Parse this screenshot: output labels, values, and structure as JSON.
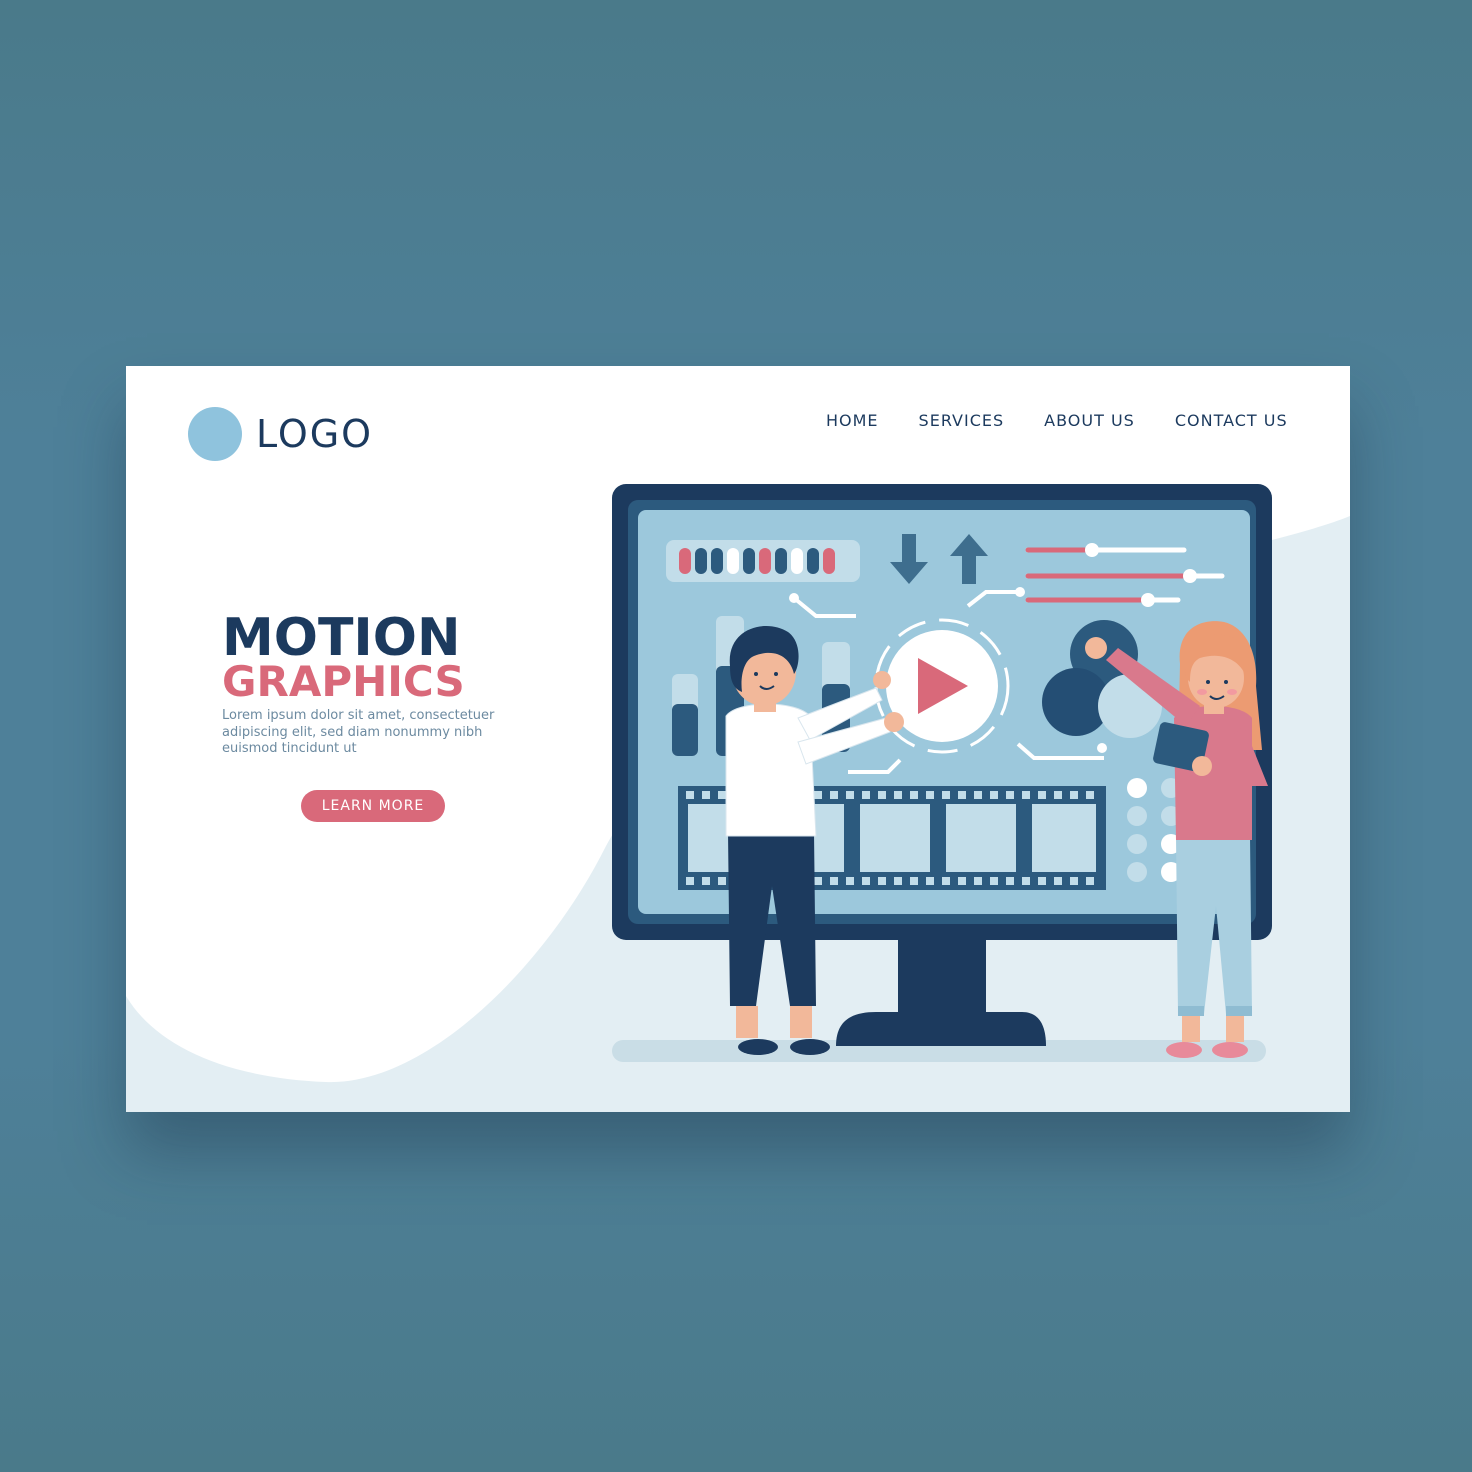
{
  "header": {
    "logo_text": "LOGO",
    "nav": [
      {
        "label": "HOME"
      },
      {
        "label": "SERVICES"
      },
      {
        "label": "ABOUT US"
      },
      {
        "label": "CONTACT US"
      }
    ]
  },
  "hero": {
    "title_line1": "MOTION",
    "title_line2": "GRAPHICS",
    "body": "Lorem ipsum dolor sit amet, consectetuer adipiscing elit, sed diam nonummy nibh euismod tincidunt ut",
    "cta_label": "LEARN MORE"
  },
  "colors": {
    "navy": "#1c3a5e",
    "coral": "#d9697a",
    "light_blue": "#8fc3dd",
    "screen_blue": "#9cc8dc",
    "background": "#4e8099"
  },
  "illustration": {
    "icons": [
      "play-icon",
      "download-arrow-icon",
      "upload-arrow-icon",
      "film-strip-icon",
      "tablet-icon"
    ]
  }
}
